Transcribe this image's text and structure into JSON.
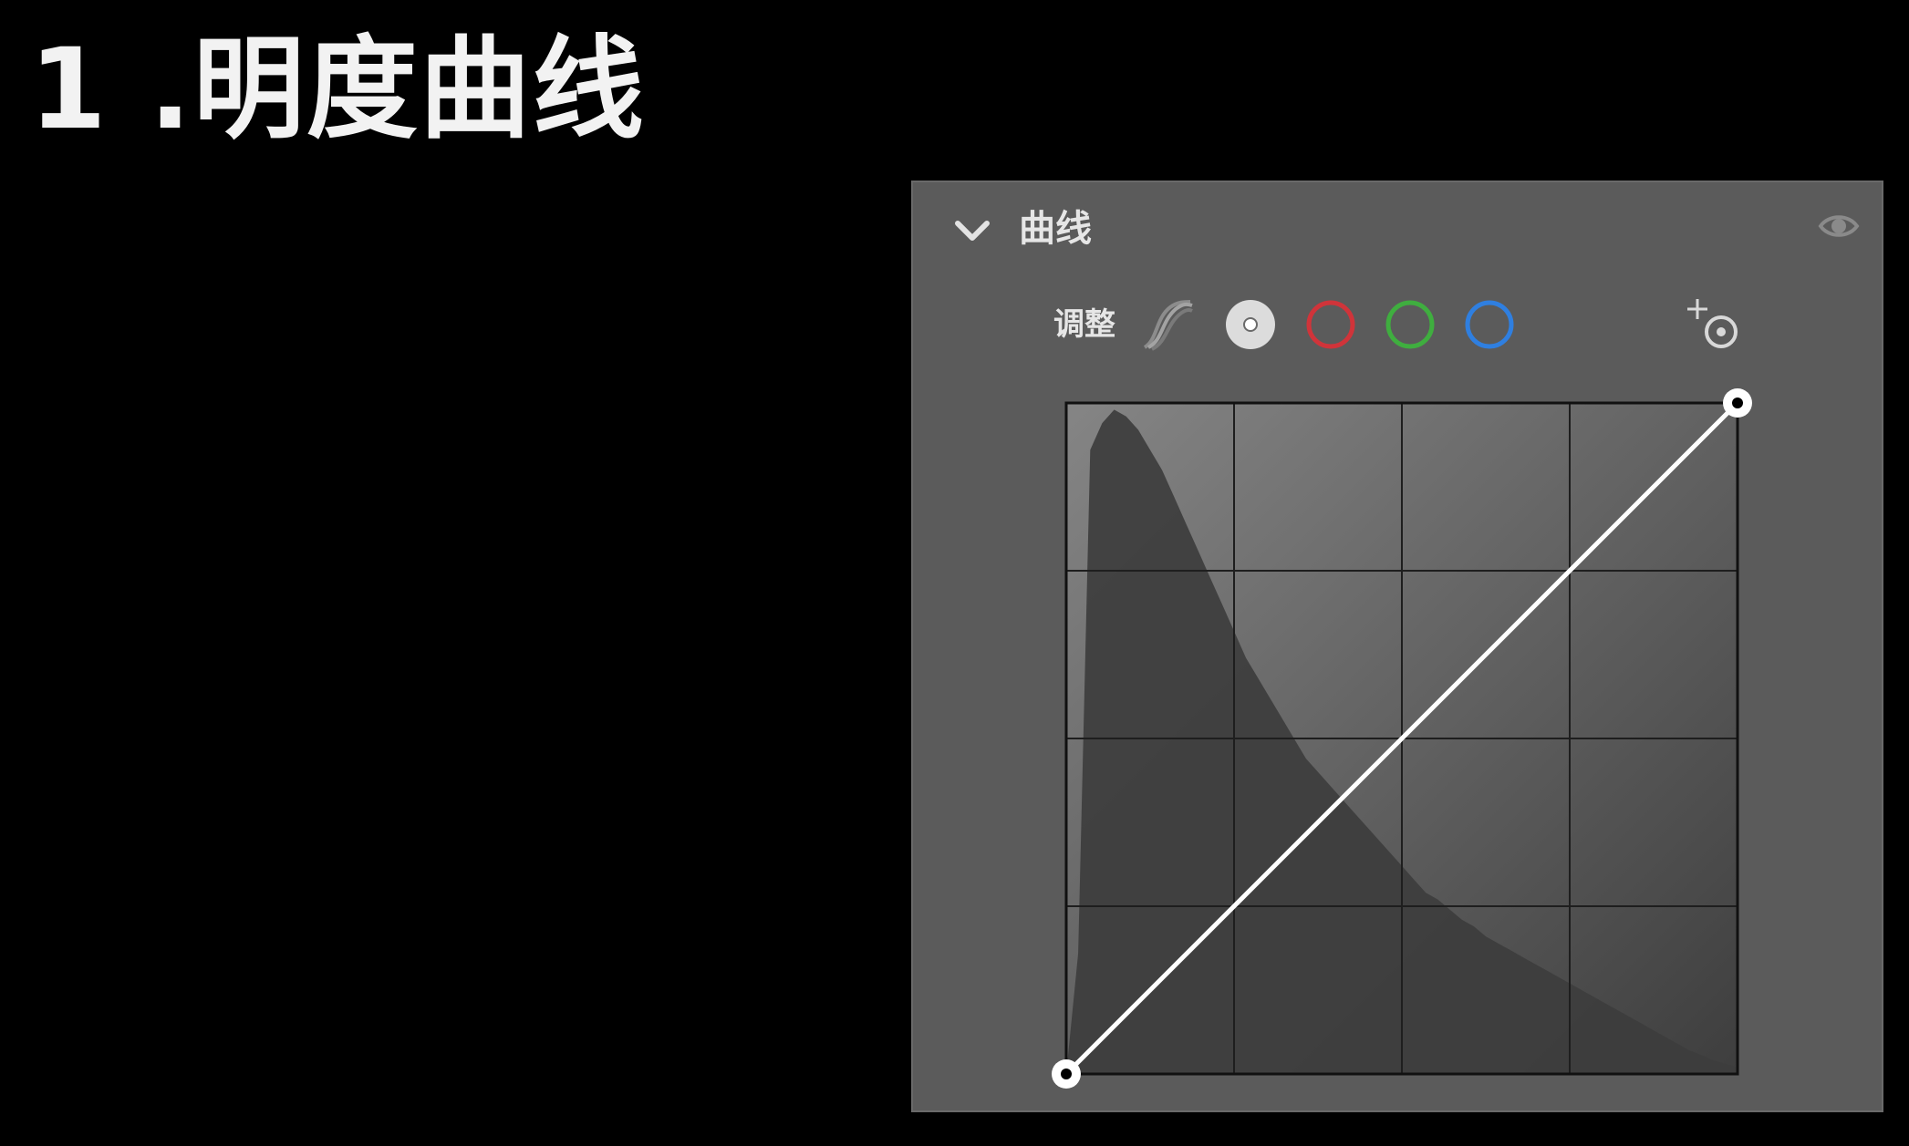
{
  "slide": {
    "title": "1 .明度曲线"
  },
  "panel": {
    "title": "曲线",
    "adjust_label": "调整",
    "channels": [
      {
        "id": "parametric",
        "icon": "parametric-curve-icon"
      },
      {
        "id": "luminance",
        "icon": "white-dot-channel-icon",
        "selected": true
      },
      {
        "id": "red",
        "icon": "red-channel-icon",
        "color": "#d0343a"
      },
      {
        "id": "green",
        "icon": "green-channel-icon",
        "color": "#3fae3f"
      },
      {
        "id": "blue",
        "icon": "blue-channel-icon",
        "color": "#2f7fe0"
      }
    ],
    "icons": {
      "collapse": "chevron-down-icon",
      "visibility": "eye-icon",
      "target": "targeted-adjustment-icon"
    }
  },
  "curve": {
    "points": [
      {
        "input": 0,
        "output": 0
      },
      {
        "input": 255,
        "output": 255
      }
    ],
    "grid_divisions": 4,
    "histogram": [
      0,
      0.18,
      0.93,
      0.97,
      0.99,
      0.98,
      0.96,
      0.93,
      0.9,
      0.86,
      0.82,
      0.78,
      0.74,
      0.7,
      0.66,
      0.62,
      0.59,
      0.56,
      0.53,
      0.5,
      0.47,
      0.45,
      0.43,
      0.41,
      0.39,
      0.37,
      0.35,
      0.33,
      0.31,
      0.29,
      0.27,
      0.26,
      0.245,
      0.23,
      0.22,
      0.205,
      0.195,
      0.185,
      0.175,
      0.165,
      0.155,
      0.145,
      0.135,
      0.125,
      0.115,
      0.105,
      0.095,
      0.085,
      0.075,
      0.065,
      0.055,
      0.045,
      0.035,
      0.028,
      0.02,
      0.015,
      0.01
    ]
  }
}
